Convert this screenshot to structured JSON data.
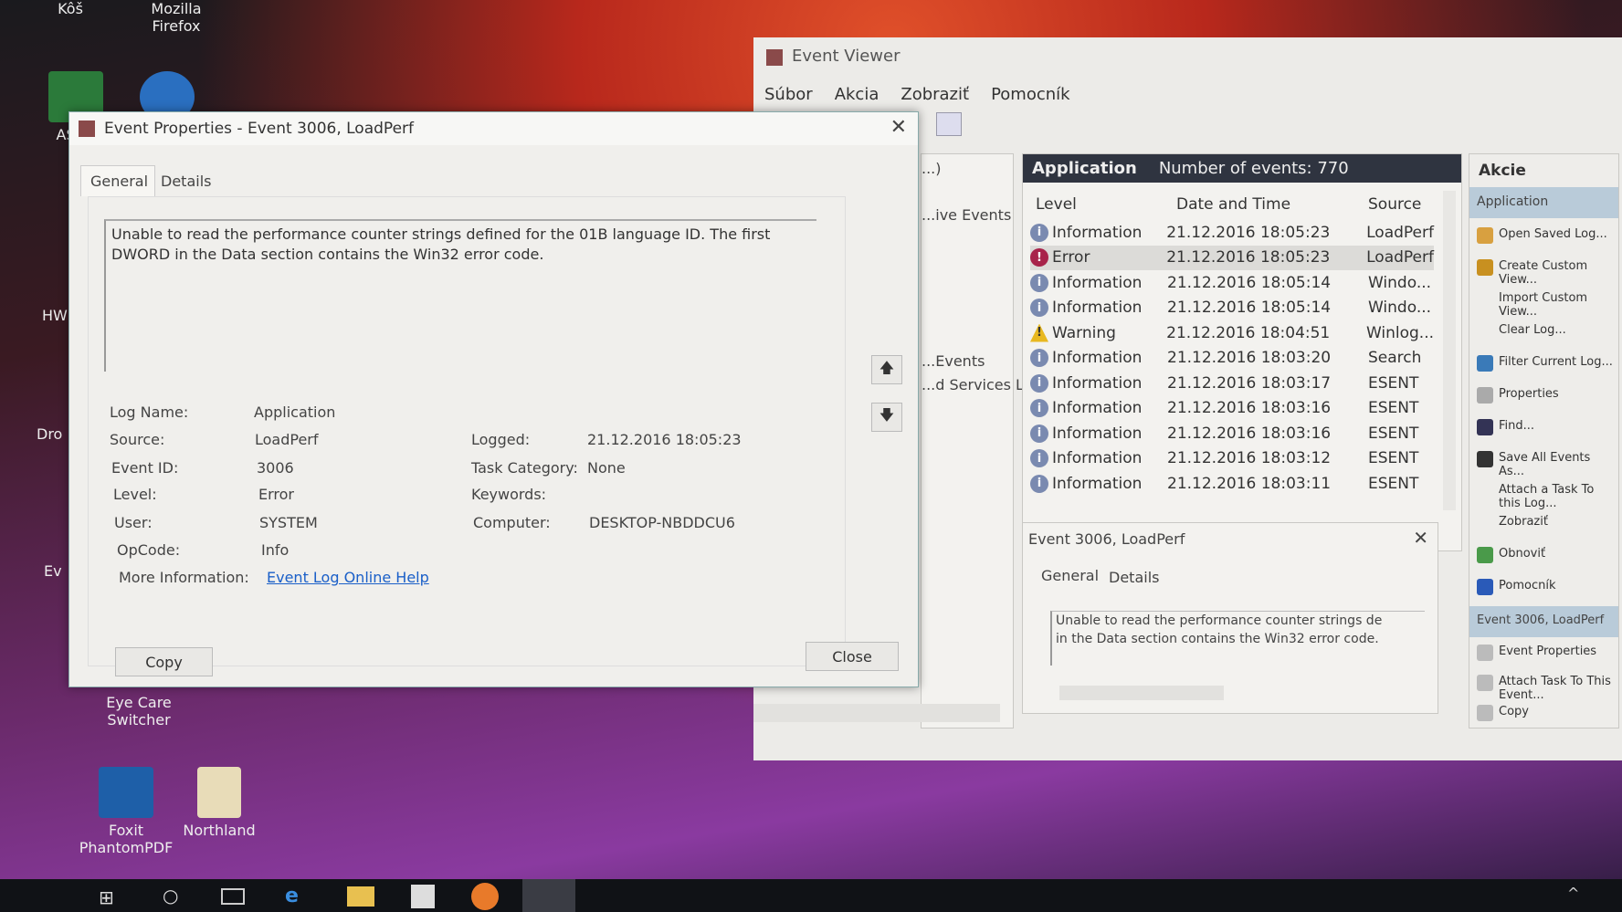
{
  "desktop": {
    "icons": [
      {
        "label": "Kôš"
      },
      {
        "label": "Mozilla Firefox"
      },
      {
        "label": "ASUS"
      },
      {
        "label": "HW"
      },
      {
        "label": "Dro"
      },
      {
        "label": "Ev"
      },
      {
        "label": "Eye Care Switcher"
      },
      {
        "label": "Foxit PhantomPDF"
      },
      {
        "label": "Northland"
      }
    ]
  },
  "event_viewer": {
    "title": "Event Viewer",
    "menu": [
      "Súbor",
      "Akcia",
      "Zobraziť",
      "Pomocník"
    ],
    "nav_partial": [
      "...)",
      "...ive Events",
      "...Events",
      "...d Services Lo..."
    ],
    "list": {
      "log_name": "Application",
      "count_label": "Number of events: 770",
      "columns": [
        "Level",
        "Date and Time",
        "Source"
      ],
      "rows": [
        {
          "level": "Information",
          "type": "info",
          "datetime": "21.12.2016 18:05:23",
          "source": "LoadPerf"
        },
        {
          "level": "Error",
          "type": "error",
          "datetime": "21.12.2016 18:05:23",
          "source": "LoadPerf"
        },
        {
          "level": "Information",
          "type": "info",
          "datetime": "21.12.2016 18:05:14",
          "source": "Windo..."
        },
        {
          "level": "Information",
          "type": "info",
          "datetime": "21.12.2016 18:05:14",
          "source": "Windo..."
        },
        {
          "level": "Warning",
          "type": "warning",
          "datetime": "21.12.2016 18:04:51",
          "source": "Winlog..."
        },
        {
          "level": "Information",
          "type": "info",
          "datetime": "21.12.2016 18:03:20",
          "source": "Search"
        },
        {
          "level": "Information",
          "type": "info",
          "datetime": "21.12.2016 18:03:17",
          "source": "ESENT"
        },
        {
          "level": "Information",
          "type": "info",
          "datetime": "21.12.2016 18:03:16",
          "source": "ESENT"
        },
        {
          "level": "Information",
          "type": "info",
          "datetime": "21.12.2016 18:03:16",
          "source": "ESENT"
        },
        {
          "level": "Information",
          "type": "info",
          "datetime": "21.12.2016 18:03:12",
          "source": "ESENT"
        },
        {
          "level": "Information",
          "type": "info",
          "datetime": "21.12.2016 18:03:11",
          "source": "ESENT"
        }
      ]
    },
    "detail": {
      "title": "Event 3006, LoadPerf",
      "tabs": [
        "General",
        "Details"
      ],
      "text": "Unable to read the performance counter strings de\nin the Data section contains the Win32 error code."
    },
    "actions": {
      "header": "Akcie",
      "section1": "Application",
      "items1": [
        "Open Saved Log...",
        "Create Custom View...",
        "Import Custom View...",
        "Clear Log...",
        "Filter Current Log...",
        "Properties",
        "Find...",
        "Save All Events As...",
        "Attach a Task To this Log...",
        "Zobraziť",
        "Obnoviť",
        "Pomocník"
      ],
      "section2": "Event 3006, LoadPerf",
      "items2": [
        "Event Properties",
        "Attach Task To This Event...",
        "Copy"
      ]
    }
  },
  "dialog": {
    "title": "Event Properties - Event 3006, LoadPerf",
    "tabs": [
      "General",
      "Details"
    ],
    "message": "Unable to read the performance counter strings defined for the 01B language ID. The first DWORD in the Data section contains the Win32 error code.",
    "fields": {
      "log_name": {
        "label": "Log Name:",
        "value": "Application"
      },
      "source": {
        "label": "Source:",
        "value": "LoadPerf"
      },
      "logged": {
        "label": "Logged:",
        "value": "21.12.2016 18:05:23"
      },
      "event_id": {
        "label": "Event ID:",
        "value": "3006"
      },
      "task_category": {
        "label": "Task Category:",
        "value": "None"
      },
      "level": {
        "label": "Level:",
        "value": "Error"
      },
      "keywords": {
        "label": "Keywords:",
        "value": ""
      },
      "user": {
        "label": "User:",
        "value": "SYSTEM"
      },
      "computer": {
        "label": "Computer:",
        "value": "DESKTOP-NBDDCU6"
      },
      "opcode": {
        "label": "OpCode:",
        "value": "Info"
      },
      "more_info": {
        "label": "More Information:",
        "value": "Event Log Online Help"
      }
    },
    "copy_label": "Copy",
    "close_label": "Close"
  },
  "colors": {
    "accent": "#2f3440",
    "link": "#1a5fc8",
    "selected": "#b9cbd9"
  }
}
